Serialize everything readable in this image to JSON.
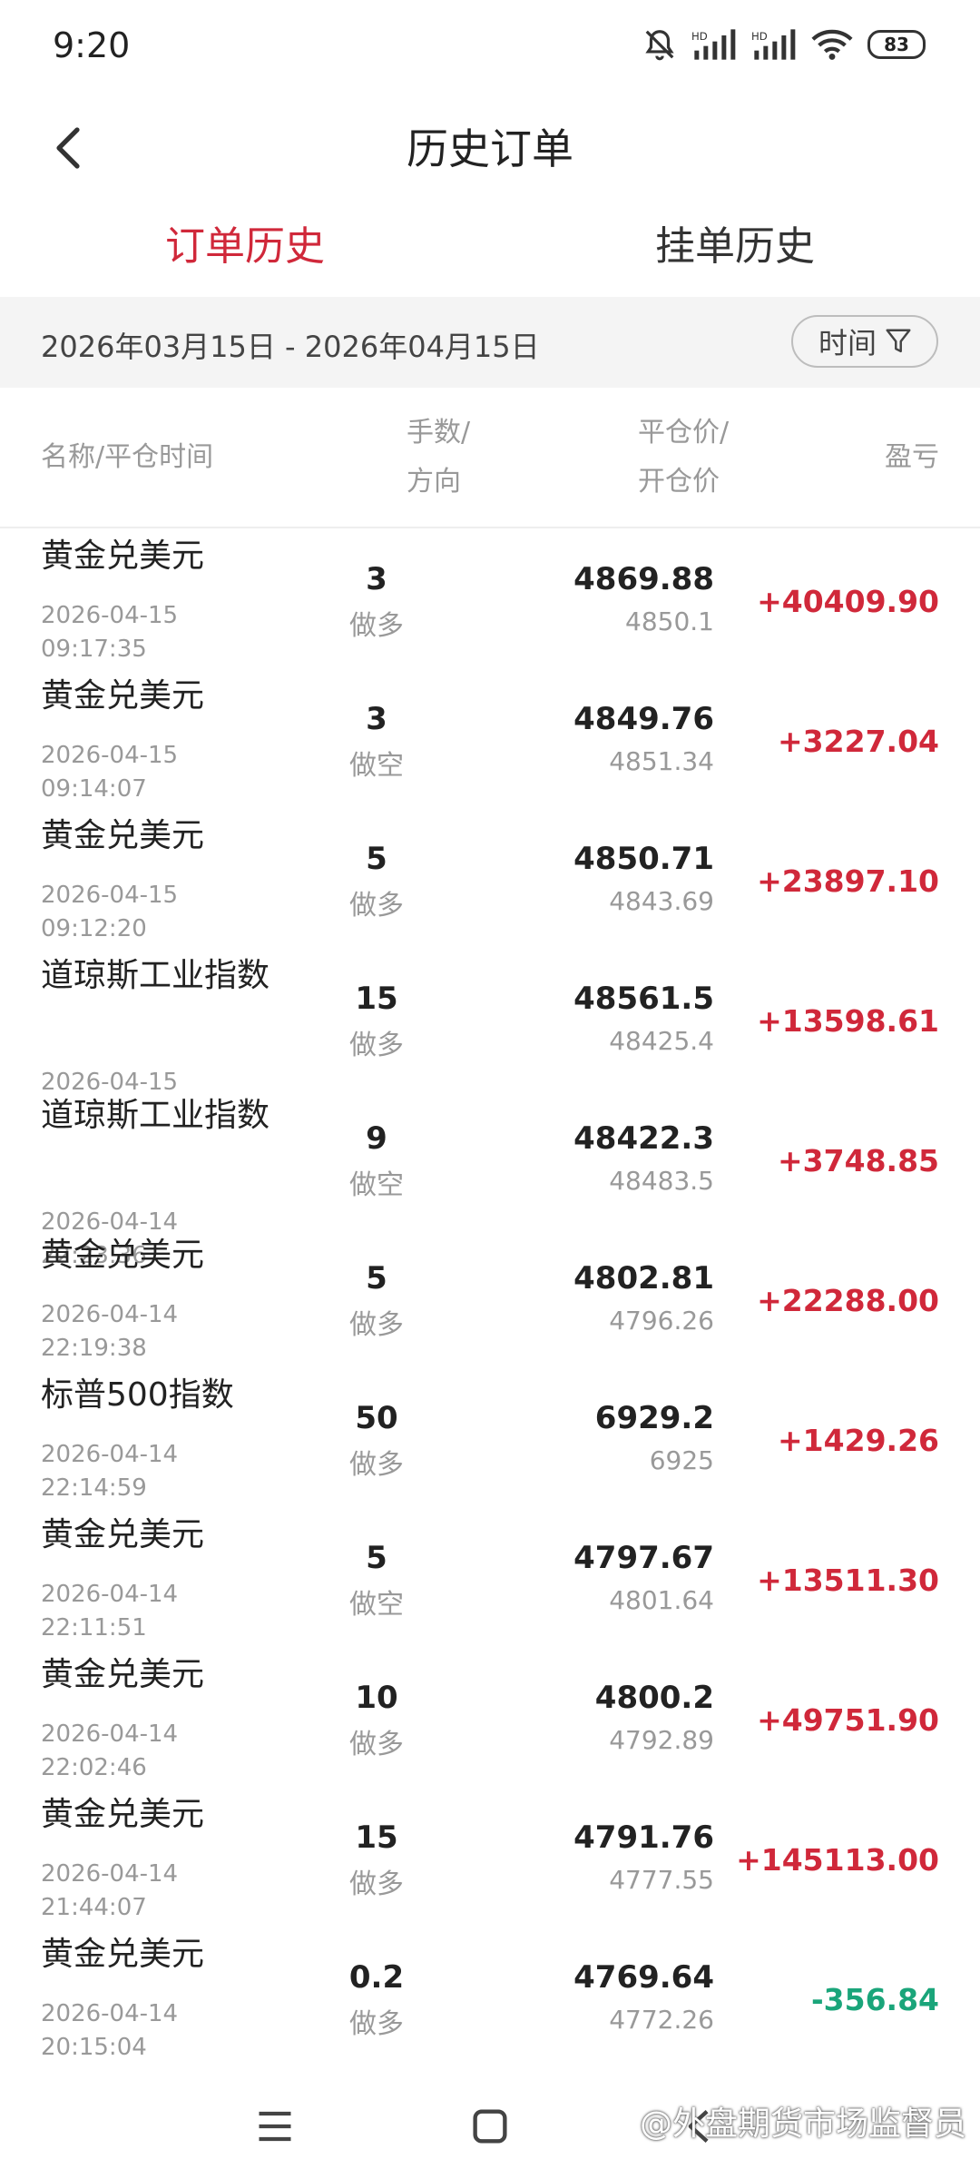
{
  "status_bar": {
    "time": "9:20",
    "battery": "83"
  },
  "header": {
    "title": "历史订单"
  },
  "tabs": [
    {
      "label": "订单历史",
      "active": true
    },
    {
      "label": "挂单历史",
      "active": false
    }
  ],
  "date_range": {
    "label": "2026年03月15日 - 2026年04月15日"
  },
  "filter": {
    "label": "时间"
  },
  "columns": {
    "name": "名称/平仓时间",
    "qty_line1": "手数/",
    "qty_line2": "方向",
    "price_line1": "平仓价/",
    "price_line2": "开仓价",
    "pnl": "盈亏"
  },
  "orders": [
    {
      "name": "黄金兑美元",
      "date": "2026-04-15",
      "time": "09:17:35",
      "qty": "3",
      "direction": "做多",
      "close_price": "4869.88",
      "open_price": "4850.1",
      "pnl": "+40409.90",
      "pnl_sign": "pos"
    },
    {
      "name": "黄金兑美元",
      "date": "2026-04-15",
      "time": "09:14:07",
      "qty": "3",
      "direction": "做空",
      "close_price": "4849.76",
      "open_price": "4851.34",
      "pnl": "+3227.04",
      "pnl_sign": "pos"
    },
    {
      "name": "黄金兑美元",
      "date": "2026-04-15",
      "time": "09:12:20",
      "qty": "5",
      "direction": "做多",
      "close_price": "4850.71",
      "open_price": "4843.69",
      "pnl": "+23897.10",
      "pnl_sign": "pos"
    },
    {
      "name": "道琼斯工业指数",
      "date": "2026-04-15",
      "time": "",
      "qty": "15",
      "direction": "做多",
      "close_price": "48561.5",
      "open_price": "48425.4",
      "pnl": "+13598.61",
      "pnl_sign": "pos"
    },
    {
      "name": "道琼斯工业指数",
      "date": "2026-04-14",
      "time": "22:23:36",
      "qty": "9",
      "direction": "做空",
      "close_price": "48422.3",
      "open_price": "48483.5",
      "pnl": "+3748.85",
      "pnl_sign": "pos"
    },
    {
      "name": "黄金兑美元",
      "date": "2026-04-14",
      "time": "22:19:38",
      "qty": "5",
      "direction": "做多",
      "close_price": "4802.81",
      "open_price": "4796.26",
      "pnl": "+22288.00",
      "pnl_sign": "pos"
    },
    {
      "name": "标普500指数",
      "date": "2026-04-14",
      "time": "22:14:59",
      "qty": "50",
      "direction": "做多",
      "close_price": "6929.2",
      "open_price": "6925",
      "pnl": "+1429.26",
      "pnl_sign": "pos"
    },
    {
      "name": "黄金兑美元",
      "date": "2026-04-14",
      "time": "22:11:51",
      "qty": "5",
      "direction": "做空",
      "close_price": "4797.67",
      "open_price": "4801.64",
      "pnl": "+13511.30",
      "pnl_sign": "pos"
    },
    {
      "name": "黄金兑美元",
      "date": "2026-04-14",
      "time": "22:02:46",
      "qty": "10",
      "direction": "做多",
      "close_price": "4800.2",
      "open_price": "4792.89",
      "pnl": "+49751.90",
      "pnl_sign": "pos"
    },
    {
      "name": "黄金兑美元",
      "date": "2026-04-14",
      "time": "21:44:07",
      "qty": "15",
      "direction": "做多",
      "close_price": "4791.76",
      "open_price": "4777.55",
      "pnl": "+145113.00",
      "pnl_sign": "pos"
    },
    {
      "name": "黄金兑美元",
      "date": "2026-04-14",
      "time": "20:15:04",
      "qty": "0.2",
      "direction": "做多",
      "close_price": "4769.64",
      "open_price": "4772.26",
      "pnl": "-356.84",
      "pnl_sign": "neg"
    }
  ],
  "watermark": "@外盘期货市场监督员",
  "colors": {
    "accent": "#d0283a",
    "profit": "#d0283a",
    "loss": "#1aa57a"
  },
  "icons": [
    "mute-icon",
    "signal-icon",
    "wifi-icon",
    "battery-icon",
    "back-arrow-icon",
    "filter-icon",
    "menu-icon",
    "home-icon",
    "nav-back-icon"
  ]
}
